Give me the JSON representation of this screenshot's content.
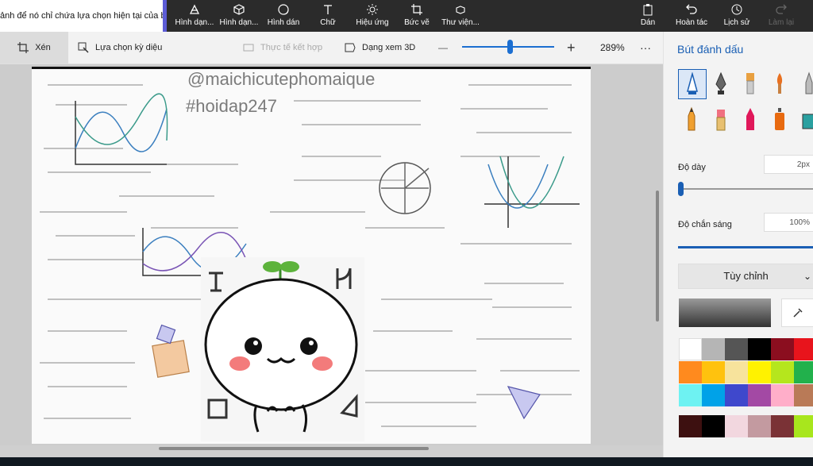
{
  "hint_text": "ảnh để nó chỉ chứa lựa chọn hiện tại của bạn.",
  "toolbar": {
    "tools": [
      {
        "label": "Hình dạn...",
        "icon": "brush-shape-icon"
      },
      {
        "label": "Hình dạn...",
        "icon": "cube-icon"
      },
      {
        "label": "Hình dán",
        "icon": "sticker-icon"
      },
      {
        "label": "Chữ",
        "icon": "text-icon"
      },
      {
        "label": "Hiệu ứng",
        "icon": "effects-icon"
      },
      {
        "label": "Bức vẽ",
        "icon": "canvas-icon"
      },
      {
        "label": "Thư viện...",
        "icon": "library-icon"
      }
    ],
    "right_tools": [
      {
        "label": "Dán",
        "icon": "paste-icon"
      },
      {
        "label": "Hoàn tác",
        "icon": "undo-icon"
      },
      {
        "label": "Lịch sử",
        "icon": "history-icon"
      },
      {
        "label": "Làm lại",
        "icon": "redo-icon"
      }
    ]
  },
  "subbar": {
    "crop_label": "Xén",
    "magic_label": "Lựa chọn kỳ diệu",
    "mixed_reality_label": "Thực tế kết hợp",
    "view3d_label": "Dạng xem 3D",
    "zoom_minus": "—",
    "zoom_plus": "+",
    "zoom_value": "289%",
    "zoom_level_fraction": 0.52,
    "more": "···"
  },
  "canvas": {
    "watermark_line1": "@maichicutephomaique",
    "watermark_line2": "#hoidap247"
  },
  "panel": {
    "title": "Bút đánh dấu",
    "thickness_label": "Độ dày",
    "thickness_value": "2px",
    "thickness_fraction": 0.0,
    "opacity_label": "Độ chắn sáng",
    "opacity_value": "100%",
    "custom_button": "Tùy chỉnh",
    "palette": [
      "#ffffff",
      "#b5b5b5",
      "#555555",
      "#000000",
      "#8b0e1f",
      "#e8141c",
      "#ff8a1e",
      "#ffc20e",
      "#f7e39c",
      "#fff200",
      "#b5e61d",
      "#22b14c",
      "#6ef2f2",
      "#00a2e8",
      "#3f48cc",
      "#a349a4",
      "#ffaec9",
      "#b97a57",
      "#3d1010",
      "#000000",
      "#f2d7df",
      "#c39aa0",
      "#7a3236",
      "#a8e61d"
    ]
  }
}
